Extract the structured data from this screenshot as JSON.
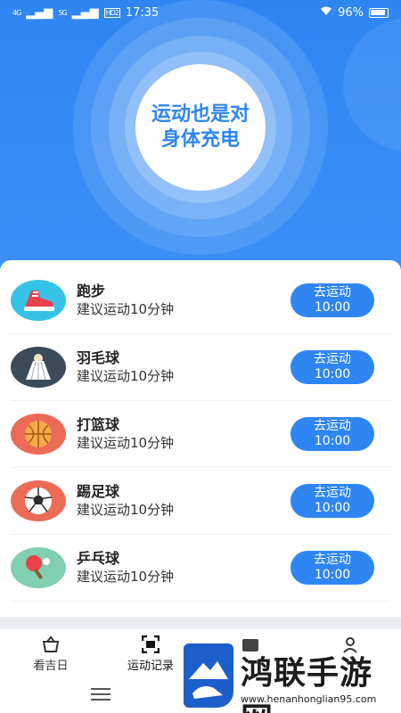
{
  "status": {
    "signal_left": "4G",
    "signal_right": "5G",
    "hd": "HD2",
    "time": "17:35",
    "battery": "96%"
  },
  "hero": {
    "slogan": "运动也是对身体充电"
  },
  "activities": [
    {
      "name": "跑步",
      "suggestion": "建议运动10分钟",
      "button": "去运动",
      "duration": "10:00",
      "icon": "running-shoe-icon"
    },
    {
      "name": "羽毛球",
      "suggestion": "建议运动10分钟",
      "button": "去运动",
      "duration": "10:00",
      "icon": "shuttlecock-icon"
    },
    {
      "name": "打篮球",
      "suggestion": "建议运动10分钟",
      "button": "去运动",
      "duration": "10:00",
      "icon": "basketball-icon"
    },
    {
      "name": "踢足球",
      "suggestion": "建议运动10分钟",
      "button": "去运动",
      "duration": "10:00",
      "icon": "soccer-ball-icon"
    },
    {
      "name": "乒乓球",
      "suggestion": "建议运动10分钟",
      "button": "去运动",
      "duration": "10:00",
      "icon": "ping-pong-icon"
    }
  ],
  "tabs": [
    {
      "label": "看吉日",
      "icon": "basket-icon"
    },
    {
      "label": "运动记录",
      "icon": "scan-frame-icon"
    },
    {
      "label": "",
      "icon": "folder-icon"
    },
    {
      "label": "",
      "icon": "user-icon"
    }
  ],
  "watermark": {
    "name": "鸿联手游网",
    "url": "www.henanhonglian95.com"
  },
  "colors": {
    "primary": "#2f86f3"
  }
}
